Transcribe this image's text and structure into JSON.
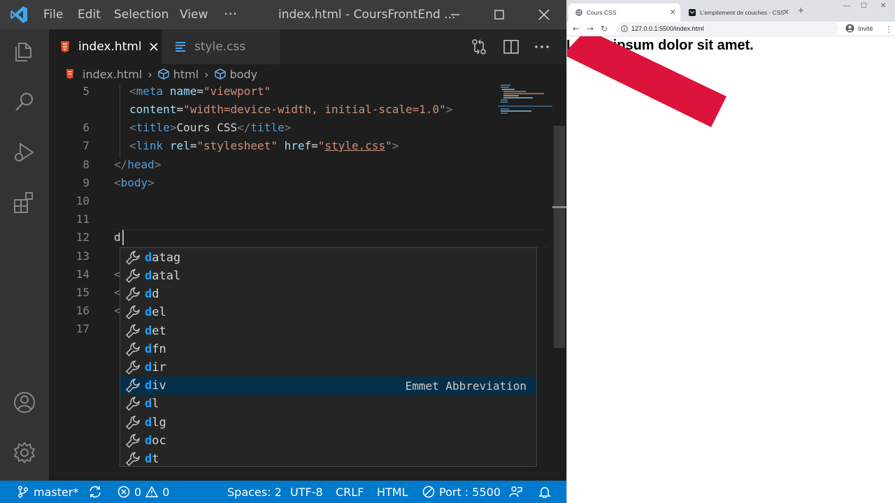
{
  "vscode": {
    "menu": [
      "File",
      "Edit",
      "Selection",
      "View",
      "···"
    ],
    "window_title": "index.html - CoursFrontEnd ...",
    "tabs": [
      {
        "label": "index.html",
        "active": true
      },
      {
        "label": "style.css",
        "active": false
      }
    ],
    "breadcrumb": [
      "index.html",
      "html",
      "body"
    ],
    "code_lines": [
      {
        "num": "5"
      },
      {
        "num": ""
      },
      {
        "num": "6"
      },
      {
        "num": "7"
      },
      {
        "num": "8"
      },
      {
        "num": "9"
      },
      {
        "num": "10"
      },
      {
        "num": "11"
      },
      {
        "num": "12"
      },
      {
        "num": "13"
      },
      {
        "num": "14"
      },
      {
        "num": "15"
      },
      {
        "num": "16"
      },
      {
        "num": "17"
      }
    ],
    "code": {
      "meta_attr_name": "name",
      "meta_name_val": "\"viewport\"",
      "content_attr": "content",
      "content_val": "\"width=device-width, initial-scale=1.0\"",
      "title_text": "Cours CSS",
      "link_rel_attr": "rel",
      "link_rel_val": "\"stylesheet\"",
      "link_href_attr": "href",
      "link_href_val": "style.css",
      "typed": "d",
      "partial_13": "<",
      "partial_15": "<",
      "partial_16": "<"
    },
    "suggestions": [
      {
        "match": "d",
        "rest": "atag",
        "selected": false
      },
      {
        "match": "d",
        "rest": "atal",
        "selected": false
      },
      {
        "match": "d",
        "rest": "d",
        "selected": false
      },
      {
        "match": "d",
        "rest": "el",
        "selected": false
      },
      {
        "match": "d",
        "rest": "et",
        "selected": false
      },
      {
        "match": "d",
        "rest": "fn",
        "selected": false
      },
      {
        "match": "d",
        "rest": "ir",
        "selected": false
      },
      {
        "match": "d",
        "rest": "iv",
        "selected": true,
        "detail": "Emmet Abbreviation"
      },
      {
        "match": "d",
        "rest": "l",
        "selected": false
      },
      {
        "match": "d",
        "rest": "lg",
        "selected": false
      },
      {
        "match": "d",
        "rest": "oc",
        "selected": false
      },
      {
        "match": "d",
        "rest": "t",
        "selected": false
      }
    ],
    "status": {
      "branch": "master*",
      "errors": "0",
      "warnings": "0",
      "spaces": "Spaces: 2",
      "encoding": "UTF-8",
      "eol": "CRLF",
      "language": "HTML",
      "port": "Port : 5500"
    },
    "colors": {
      "accent": "#007acc",
      "editor_bg": "#1e1e1e",
      "tag": "#569cd6",
      "attr": "#9cdcfe",
      "string": "#ce9178",
      "match": "#18a3ff"
    }
  },
  "chrome": {
    "tabs": [
      {
        "title": "Cours CSS"
      },
      {
        "title": "L'empilement de couches - CSS"
      }
    ],
    "new_tab": "+",
    "url": "127.0.0.1:5500/index.html",
    "profile": "Invité",
    "page_text": "Lorem ipsum dolor sit amet.",
    "band_color": "#dc143c"
  }
}
